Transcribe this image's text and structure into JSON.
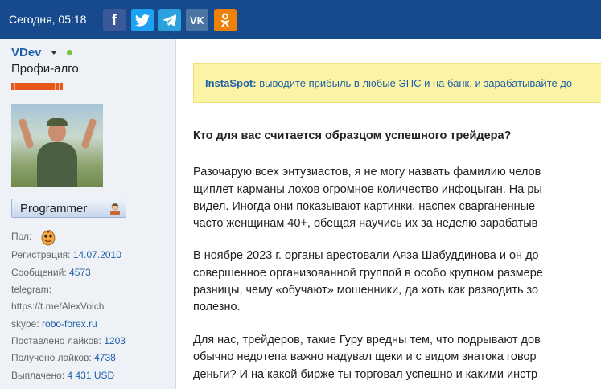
{
  "header": {
    "date": "Сегодня, 05:18",
    "share": [
      {
        "name": "facebook",
        "glyph": "f"
      },
      {
        "name": "twitter",
        "glyph": ""
      },
      {
        "name": "telegram",
        "glyph": ""
      },
      {
        "name": "vk",
        "glyph": "VK"
      },
      {
        "name": "odnoklassniki",
        "glyph": ""
      }
    ]
  },
  "user": {
    "name": "VDev",
    "title": "Профи-алго",
    "badge": "Programmer",
    "gender_label": "Пол:",
    "reg_label": "Регистрация:",
    "reg_value": "14.07.2010",
    "posts_label": "Сообщений:",
    "posts_value": "4573",
    "telegram_label": "telegram:",
    "telegram_value": "https://t.me/AlexVolch",
    "skype_label": "skype:",
    "skype_value": "robo-forex.ru",
    "likes_given_label": "Поставлено лайков:",
    "likes_given_value": "1203",
    "likes_recv_label": "Получено лайков:",
    "likes_recv_value": "4738",
    "paid_label": "Выплачено:",
    "paid_value": "4 431 USD"
  },
  "ad": {
    "brand": "InstaSpot:",
    "link": "выводите прибыль в любые ЭПС и на банк, и зарабатывайте до"
  },
  "post": {
    "heading": "Кто для вас считается образцом успешного трейдера?",
    "p1": [
      "Разочарую всех энтузиастов, я не могу назвать фамилию челов",
      "щиплет карманы лохов огромное количество инфоцыган. На ры",
      "видел. Иногда они показывают картинки, наспех сварганенные",
      "часто женщинам 40+, обещая научись их за неделю зарабатыв"
    ],
    "p2": [
      "В ноябре 2023 г. органы арестовали Аяза Шабуддинова и он до",
      "совершенное организованной группой в особо крупном размере",
      "разницы, чему «обучают» мошенники, да хоть как разводить зо",
      "полезно."
    ],
    "p3": [
      "Для нас, трейдеров, такие Гуру вредны тем, что подрывают дов",
      "обычно недотепа важно надувал щеки и с видом знатока говор",
      "деньги? И на какой бирже ты торговал успешно и какими инстр"
    ]
  }
}
